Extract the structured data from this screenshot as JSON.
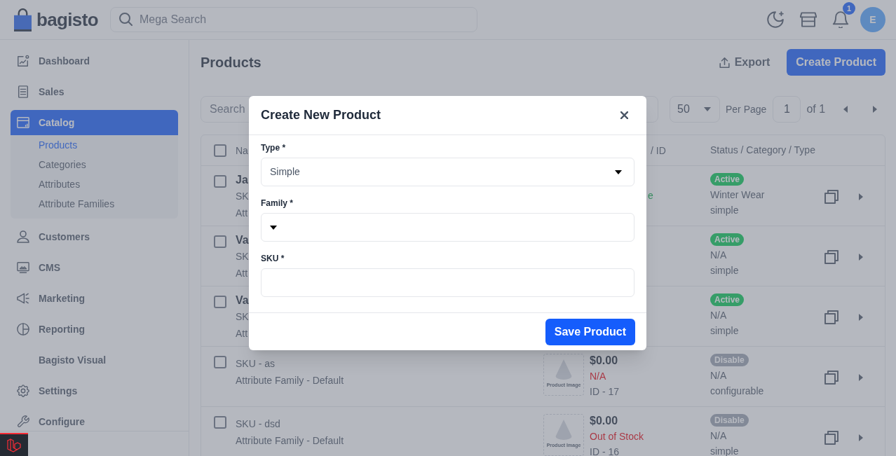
{
  "header": {
    "logo": "bagisto",
    "search": {
      "placeholder": "Mega Search"
    },
    "notification_count": "1",
    "avatar": "E"
  },
  "sidebar": {
    "items": [
      {
        "label": "Dashboard",
        "selected": false
      },
      {
        "label": "Sales",
        "selected": false
      },
      {
        "label": "Catalog",
        "selected": true,
        "expanded": true,
        "children": [
          {
            "label": "Products",
            "selected": true
          },
          {
            "label": "Categories",
            "selected": false
          },
          {
            "label": "Attributes",
            "selected": false
          },
          {
            "label": "Attribute Families",
            "selected": false
          }
        ]
      },
      {
        "label": "Customers",
        "selected": false
      },
      {
        "label": "CMS",
        "selected": false
      },
      {
        "label": "Marketing",
        "selected": false
      },
      {
        "label": "Reporting",
        "selected": false
      },
      {
        "label": "Bagisto Visual",
        "selected": false
      },
      {
        "label": "Settings",
        "selected": false
      },
      {
        "label": "Configure",
        "selected": false
      }
    ]
  },
  "page": {
    "title": "Products",
    "export_button": "Export",
    "create_button": "Create Product"
  },
  "toolbar": {
    "search": {
      "placeholder": "Search"
    },
    "per_page": {
      "value": "50",
      "label": "Per Page"
    },
    "page": {
      "value": "1",
      "total": "of 1"
    }
  },
  "table": {
    "header": {
      "checked": false,
      "column_1": "Na",
      "column_2": "/ ID",
      "column_3": "Status / Category / Type"
    },
    "rows": [
      {
        "checked": false,
        "name": "Ja",
        "sku": "SK",
        "family": "Att",
        "stock": "e",
        "in_stock": true,
        "status": "Active",
        "active": true,
        "category": "Winter Wear",
        "type": "simple"
      },
      {
        "checked": false,
        "name": "Va",
        "sku": "SK",
        "family": "Att",
        "status": "Active",
        "active": true,
        "category": "N/A",
        "type": "simple"
      },
      {
        "checked": false,
        "name": "Va",
        "sku": "SK",
        "family": "Att",
        "status": "Active",
        "active": true,
        "category": "N/A",
        "type": "simple"
      },
      {
        "checked": false,
        "sku": "SKU - as",
        "family": "Attribute Family - Default",
        "image_label": "Product Image",
        "price": "$0.00",
        "stock": "N/A",
        "in_stock": false,
        "id": "ID - 17",
        "status": "Disable",
        "active": false,
        "category": "N/A",
        "type": "configurable"
      },
      {
        "checked": false,
        "sku": "SKU - dsd",
        "family": "Attribute Family - Default",
        "image_label": "Product Image",
        "price": "$0.00",
        "stock": "Out of Stock",
        "in_stock": false,
        "id": "ID - 16",
        "status": "Disable",
        "active": false,
        "category": "N/A",
        "type": "simple"
      }
    ]
  },
  "modal": {
    "title": "Create New Product",
    "fields": [
      {
        "kind": "select",
        "label": "Type *",
        "value": "Simple"
      },
      {
        "kind": "select",
        "label": "Family *"
      },
      {
        "kind": "input",
        "label": "SKU *"
      }
    ],
    "save_button": "Save Product"
  }
}
